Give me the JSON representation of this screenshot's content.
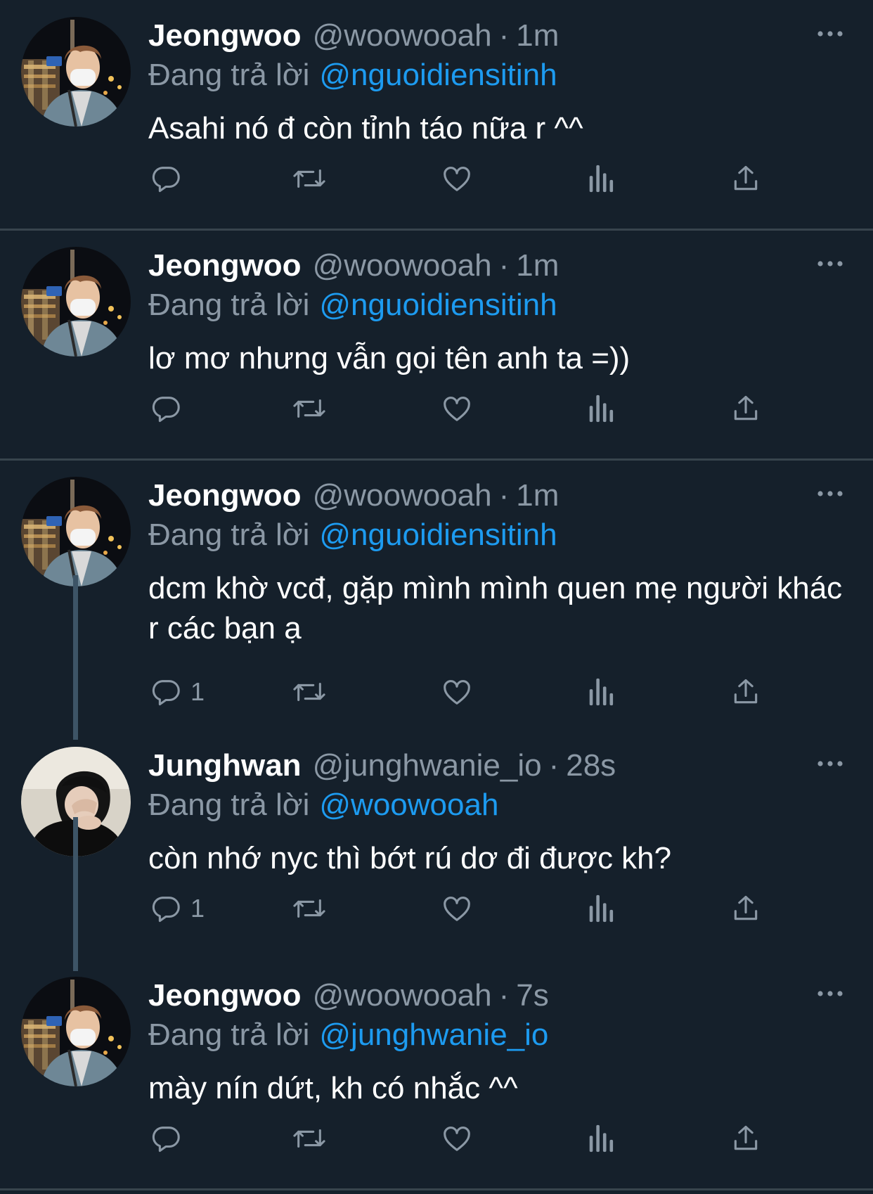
{
  "colors": {
    "background": "#15202b",
    "secondary_text": "#8b98a5",
    "mention": "#1d9bf0",
    "divider": "#38444d",
    "thread_line": "#3d5466"
  },
  "tweets": [
    {
      "name": "Jeongwoo",
      "handle": "@woowooah",
      "dot": "·",
      "time": "1m",
      "reply_prefix": "Đang trả lời",
      "reply_to": "@nguoidiensitinh",
      "text": "Asahi nó đ còn tỉnh táo nữa r ^^",
      "reply_count": "",
      "avatar": "jeongwoo-avatar"
    },
    {
      "name": "Jeongwoo",
      "handle": "@woowooah",
      "dot": "·",
      "time": "1m",
      "reply_prefix": "Đang trả lời",
      "reply_to": "@nguoidiensitinh",
      "text": "lơ mơ nhưng vẫn gọi tên anh ta =))",
      "reply_count": "",
      "avatar": "jeongwoo-avatar"
    },
    {
      "name": "Jeongwoo",
      "handle": "@woowooah",
      "dot": "·",
      "time": "1m",
      "reply_prefix": "Đang trả lời",
      "reply_to": "@nguoidiensitinh",
      "text": "dcm khờ vcđ, gặp mình mình quen mẹ người khác r các bạn ạ",
      "reply_count": "1",
      "avatar": "jeongwoo-avatar"
    },
    {
      "name": "Junghwan",
      "handle": "@junghwanie_io",
      "dot": "·",
      "time": "28s",
      "reply_prefix": "Đang trả lời",
      "reply_to": "@woowooah",
      "text": "còn nhớ nyc thì bớt rú dơ đi được kh?",
      "reply_count": "1",
      "avatar": "junghwan-avatar"
    },
    {
      "name": "Jeongwoo",
      "handle": "@woowooah",
      "dot": "·",
      "time": "7s",
      "reply_prefix": "Đang trả lời",
      "reply_to": "@junghwanie_io",
      "text": "mày nín dứt, kh có nhắc ^^",
      "reply_count": "",
      "avatar": "jeongwoo-avatar"
    }
  ],
  "icons": {
    "reply": "comment-icon",
    "retweet": "retweet-icon",
    "like": "heart-icon",
    "views": "analytics-icon",
    "share": "share-icon",
    "more": "more-icon"
  }
}
